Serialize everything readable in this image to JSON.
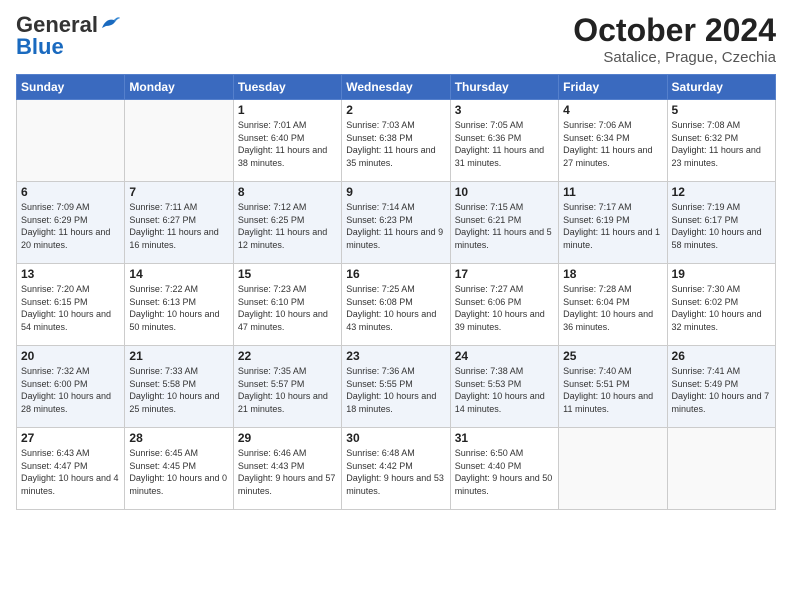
{
  "header": {
    "logo_general": "General",
    "logo_blue": "Blue",
    "month": "October 2024",
    "location": "Satalice, Prague, Czechia"
  },
  "weekdays": [
    "Sunday",
    "Monday",
    "Tuesday",
    "Wednesday",
    "Thursday",
    "Friday",
    "Saturday"
  ],
  "weeks": [
    [
      {
        "day": "",
        "info": ""
      },
      {
        "day": "",
        "info": ""
      },
      {
        "day": "1",
        "info": "Sunrise: 7:01 AM\nSunset: 6:40 PM\nDaylight: 11 hours and 38 minutes."
      },
      {
        "day": "2",
        "info": "Sunrise: 7:03 AM\nSunset: 6:38 PM\nDaylight: 11 hours and 35 minutes."
      },
      {
        "day": "3",
        "info": "Sunrise: 7:05 AM\nSunset: 6:36 PM\nDaylight: 11 hours and 31 minutes."
      },
      {
        "day": "4",
        "info": "Sunrise: 7:06 AM\nSunset: 6:34 PM\nDaylight: 11 hours and 27 minutes."
      },
      {
        "day": "5",
        "info": "Sunrise: 7:08 AM\nSunset: 6:32 PM\nDaylight: 11 hours and 23 minutes."
      }
    ],
    [
      {
        "day": "6",
        "info": "Sunrise: 7:09 AM\nSunset: 6:29 PM\nDaylight: 11 hours and 20 minutes."
      },
      {
        "day": "7",
        "info": "Sunrise: 7:11 AM\nSunset: 6:27 PM\nDaylight: 11 hours and 16 minutes."
      },
      {
        "day": "8",
        "info": "Sunrise: 7:12 AM\nSunset: 6:25 PM\nDaylight: 11 hours and 12 minutes."
      },
      {
        "day": "9",
        "info": "Sunrise: 7:14 AM\nSunset: 6:23 PM\nDaylight: 11 hours and 9 minutes."
      },
      {
        "day": "10",
        "info": "Sunrise: 7:15 AM\nSunset: 6:21 PM\nDaylight: 11 hours and 5 minutes."
      },
      {
        "day": "11",
        "info": "Sunrise: 7:17 AM\nSunset: 6:19 PM\nDaylight: 11 hours and 1 minute."
      },
      {
        "day": "12",
        "info": "Sunrise: 7:19 AM\nSunset: 6:17 PM\nDaylight: 10 hours and 58 minutes."
      }
    ],
    [
      {
        "day": "13",
        "info": "Sunrise: 7:20 AM\nSunset: 6:15 PM\nDaylight: 10 hours and 54 minutes."
      },
      {
        "day": "14",
        "info": "Sunrise: 7:22 AM\nSunset: 6:13 PM\nDaylight: 10 hours and 50 minutes."
      },
      {
        "day": "15",
        "info": "Sunrise: 7:23 AM\nSunset: 6:10 PM\nDaylight: 10 hours and 47 minutes."
      },
      {
        "day": "16",
        "info": "Sunrise: 7:25 AM\nSunset: 6:08 PM\nDaylight: 10 hours and 43 minutes."
      },
      {
        "day": "17",
        "info": "Sunrise: 7:27 AM\nSunset: 6:06 PM\nDaylight: 10 hours and 39 minutes."
      },
      {
        "day": "18",
        "info": "Sunrise: 7:28 AM\nSunset: 6:04 PM\nDaylight: 10 hours and 36 minutes."
      },
      {
        "day": "19",
        "info": "Sunrise: 7:30 AM\nSunset: 6:02 PM\nDaylight: 10 hours and 32 minutes."
      }
    ],
    [
      {
        "day": "20",
        "info": "Sunrise: 7:32 AM\nSunset: 6:00 PM\nDaylight: 10 hours and 28 minutes."
      },
      {
        "day": "21",
        "info": "Sunrise: 7:33 AM\nSunset: 5:58 PM\nDaylight: 10 hours and 25 minutes."
      },
      {
        "day": "22",
        "info": "Sunrise: 7:35 AM\nSunset: 5:57 PM\nDaylight: 10 hours and 21 minutes."
      },
      {
        "day": "23",
        "info": "Sunrise: 7:36 AM\nSunset: 5:55 PM\nDaylight: 10 hours and 18 minutes."
      },
      {
        "day": "24",
        "info": "Sunrise: 7:38 AM\nSunset: 5:53 PM\nDaylight: 10 hours and 14 minutes."
      },
      {
        "day": "25",
        "info": "Sunrise: 7:40 AM\nSunset: 5:51 PM\nDaylight: 10 hours and 11 minutes."
      },
      {
        "day": "26",
        "info": "Sunrise: 7:41 AM\nSunset: 5:49 PM\nDaylight: 10 hours and 7 minutes."
      }
    ],
    [
      {
        "day": "27",
        "info": "Sunrise: 6:43 AM\nSunset: 4:47 PM\nDaylight: 10 hours and 4 minutes."
      },
      {
        "day": "28",
        "info": "Sunrise: 6:45 AM\nSunset: 4:45 PM\nDaylight: 10 hours and 0 minutes."
      },
      {
        "day": "29",
        "info": "Sunrise: 6:46 AM\nSunset: 4:43 PM\nDaylight: 9 hours and 57 minutes."
      },
      {
        "day": "30",
        "info": "Sunrise: 6:48 AM\nSunset: 4:42 PM\nDaylight: 9 hours and 53 minutes."
      },
      {
        "day": "31",
        "info": "Sunrise: 6:50 AM\nSunset: 4:40 PM\nDaylight: 9 hours and 50 minutes."
      },
      {
        "day": "",
        "info": ""
      },
      {
        "day": "",
        "info": ""
      }
    ]
  ]
}
